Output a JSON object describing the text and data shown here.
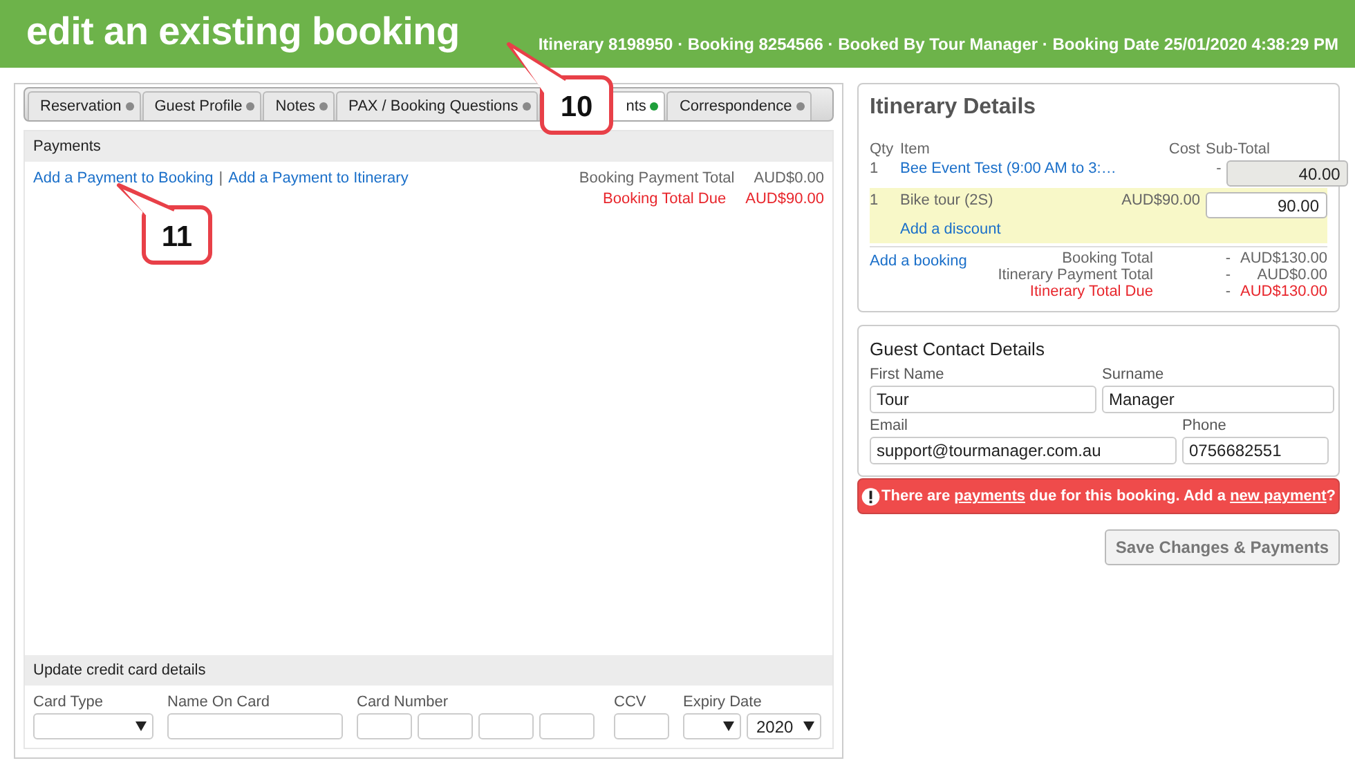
{
  "header": {
    "title": "edit an existing booking",
    "meta": "Itinerary 8198950 · Booking 8254566 · Booked By Tour Manager · Booking Date 25/01/2020 4:38:29 PM"
  },
  "tabs": [
    {
      "label": "Reservation",
      "selected": false,
      "color": "#8a8a8a"
    },
    {
      "label": "Guest Profile",
      "selected": false,
      "color": "#8a8a8a"
    },
    {
      "label": "Notes",
      "selected": false,
      "color": "#8a8a8a"
    },
    {
      "label": "PAX / Booking Questions",
      "selected": false,
      "color": "#8a8a8a"
    },
    {
      "label": "nts",
      "selected": true,
      "color": "#1e9e3a"
    },
    {
      "label": "Correspondence",
      "selected": false,
      "color": "#8a8a8a"
    }
  ],
  "payments": {
    "title": "Payments",
    "links": [
      "Add a Payment to Booking",
      "Add a Payment to Itinerary"
    ],
    "separator": "|",
    "totals": [
      {
        "label": "Booking Payment Total",
        "value": "AUD$0.00",
        "kind": "normal"
      },
      {
        "label": "Booking Total Due",
        "value": "AUD$90.00",
        "kind": "due"
      }
    ]
  },
  "card": {
    "title": "Update credit card details",
    "fields": [
      {
        "label": "Card Type",
        "kind": "select"
      },
      {
        "label": "Name On Card",
        "kind": "text"
      },
      {
        "label": "Card Number",
        "kind": "card-number"
      },
      {
        "label": "CCV",
        "kind": "short"
      },
      {
        "label": "Expiry Date",
        "kind": "expiry",
        "year": "2020"
      }
    ]
  },
  "itinerary": {
    "title": "Itinerary Details",
    "columns": [
      "Qty",
      "Item",
      "Cost",
      "Sub-Total"
    ],
    "rows": [
      {
        "qty": "1",
        "item": "Bee Event Test (9:00 AM to 3:…",
        "item_link": true,
        "cost": "-",
        "subtotal": "40.00",
        "disabled": true,
        "highlighted": false
      },
      {
        "qty": "1",
        "item": "Bike tour (2S)",
        "item_link": false,
        "cost": "AUD$90.00",
        "subtotal": "90.00",
        "disabled": false,
        "highlighted": true,
        "discount": "Add a discount"
      }
    ],
    "add_booking": "Add a booking",
    "totals": [
      {
        "label": "Booking Total",
        "dash": "-",
        "value": "AUD$130.00",
        "kind": "normal"
      },
      {
        "label": "Itinerary Payment Total",
        "dash": "-",
        "value": "AUD$0.00",
        "kind": "normal"
      },
      {
        "label": "Itinerary Total Due",
        "dash": "-",
        "value": "AUD$130.00",
        "kind": "due"
      }
    ]
  },
  "guest": {
    "title": "Guest Contact Details",
    "fields": [
      {
        "label": "First Name",
        "value": "Tour"
      },
      {
        "label": "Surname",
        "value": "Manager"
      },
      {
        "label": "Email",
        "value": "support@tourmanager.com.au"
      },
      {
        "label": "Phone",
        "value": "0756682551"
      }
    ]
  },
  "alert": {
    "parts": [
      {
        "text": "There are ",
        "link": false
      },
      {
        "text": "payments",
        "link": true
      },
      {
        "text": " due for this booking. Add a ",
        "link": false
      },
      {
        "text": "new payment",
        "link": true
      },
      {
        "text": "?",
        "link": false
      }
    ]
  },
  "save_button": "Save Changes & Payments",
  "callouts": [
    {
      "number": "10"
    },
    {
      "number": "11"
    }
  ]
}
